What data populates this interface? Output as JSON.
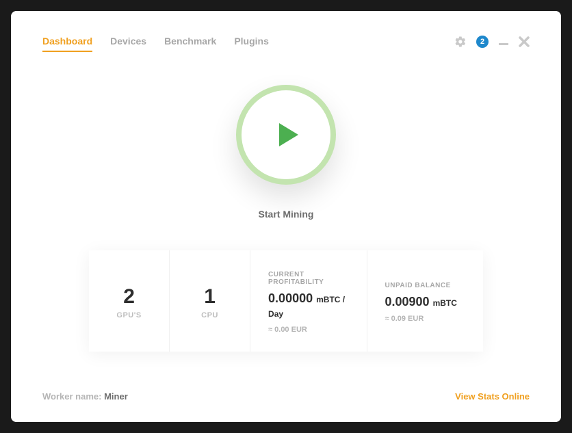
{
  "tabs": [
    "Dashboard",
    "Devices",
    "Benchmark",
    "Plugins"
  ],
  "activeTab": "Dashboard",
  "notifCount": "2",
  "startLabel": "Start Mining",
  "stats": {
    "gpu": {
      "count": "2",
      "label": "GPU'S"
    },
    "cpu": {
      "count": "1",
      "label": "CPU"
    },
    "profit": {
      "heading": "CURRENT PROFITABILITY",
      "value": "0.00000",
      "unit": "mBTC / Day",
      "sub": "≈ 0.00 EUR"
    },
    "balance": {
      "heading": "UNPAID BALANCE",
      "value": "0.00900",
      "unit": "mBTC",
      "sub": "≈ 0.09 EUR"
    }
  },
  "footer": {
    "workerLabel": "Worker name:",
    "workerName": "Miner",
    "statsLink": "View Stats Online"
  }
}
